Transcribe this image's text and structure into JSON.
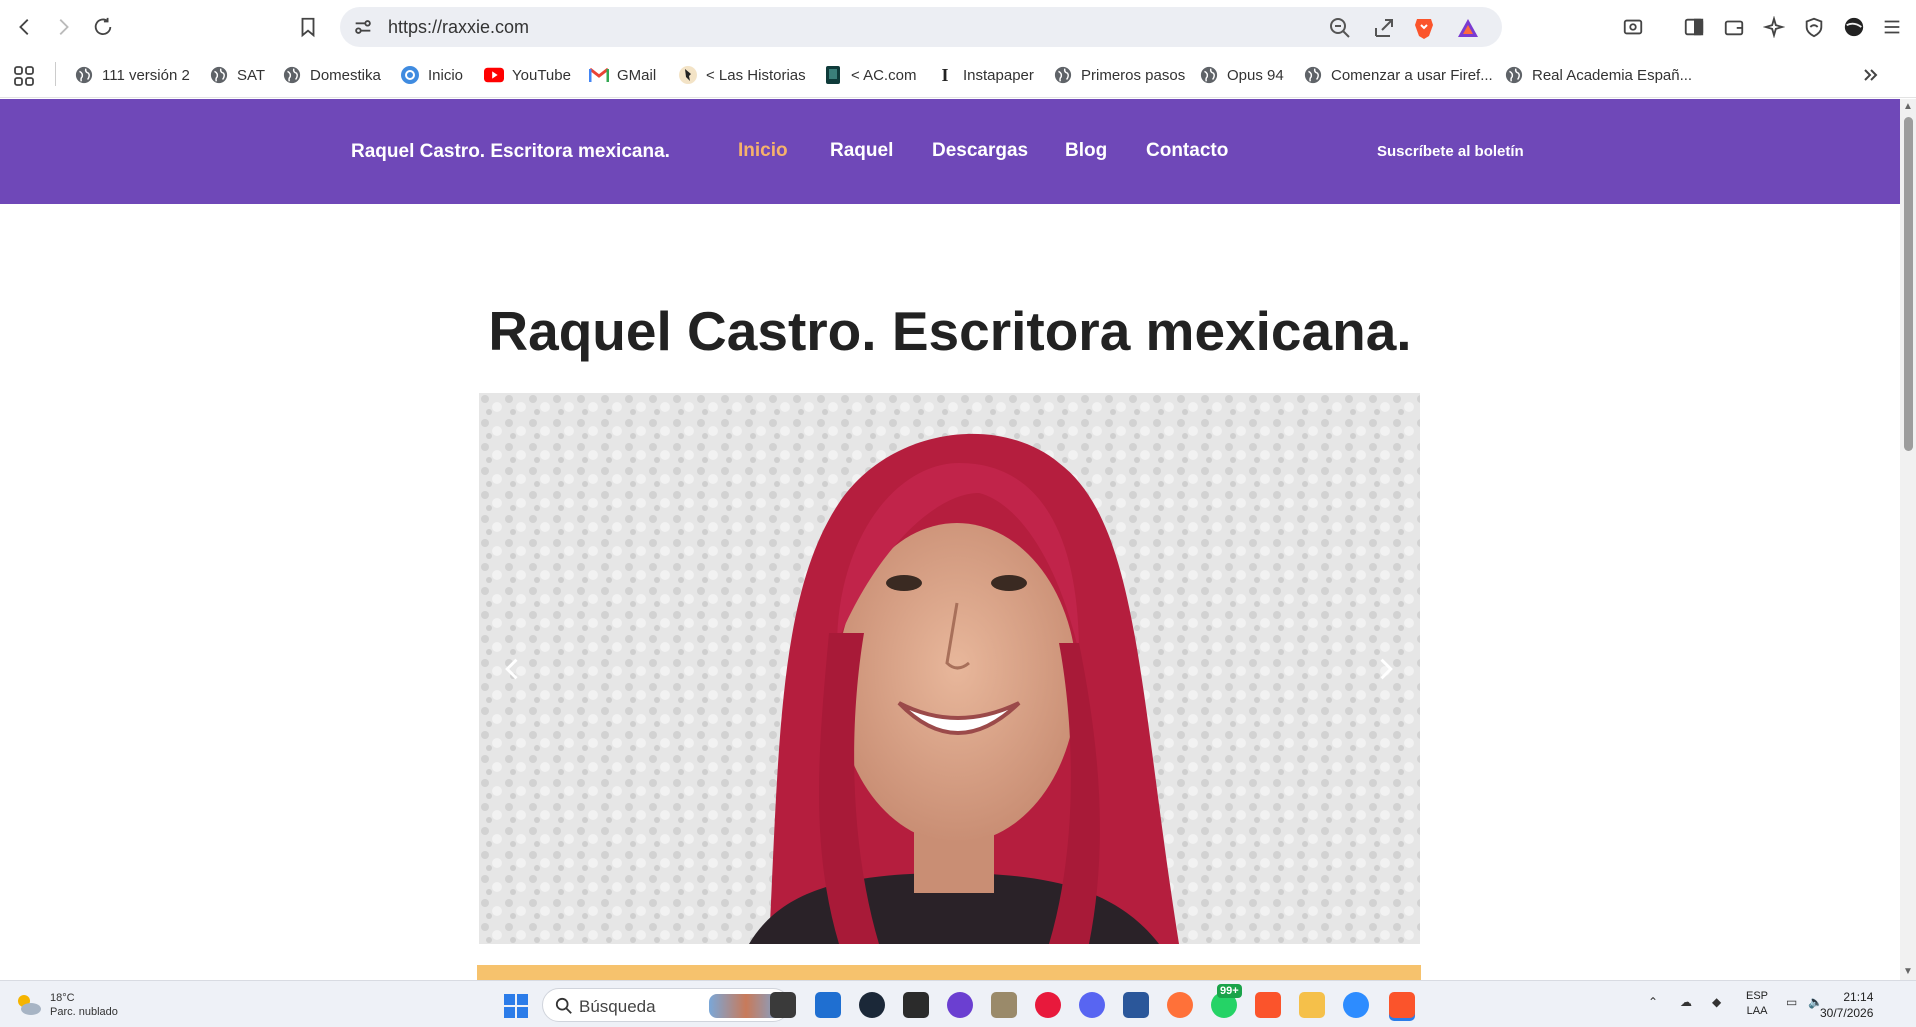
{
  "browser": {
    "url": "https://raxxie.com",
    "toolbar_icons": [
      "back-icon",
      "forward-icon",
      "reload-icon",
      "bookmark-icon",
      "site-info-icon",
      "zoom-icon",
      "share-icon",
      "brave-shield-icon",
      "brave-rewards-icon",
      "reader-mode-icon",
      "sidebar-icon",
      "wallet-icon",
      "leo-ai-icon",
      "vpn-icon",
      "profile-icon",
      "menu-icon"
    ]
  },
  "bookmarks": [
    {
      "label": "111 versión 2",
      "icon": "globe-icon"
    },
    {
      "label": "SAT",
      "icon": "globe-icon"
    },
    {
      "label": "Domestika",
      "icon": "globe-icon"
    },
    {
      "label": "Inicio",
      "icon": "canva-icon"
    },
    {
      "label": "YouTube",
      "icon": "youtube-icon"
    },
    {
      "label": "GMail",
      "icon": "gmail-icon"
    },
    {
      "label": "< Las Historias",
      "icon": "bird-icon"
    },
    {
      "label": "< AC.com",
      "icon": "book-icon"
    },
    {
      "label": "Instapaper",
      "icon": "instapaper-icon"
    },
    {
      "label": "Primeros pasos",
      "icon": "globe-icon"
    },
    {
      "label": "Opus 94",
      "icon": "globe-icon"
    },
    {
      "label": "Comenzar a usar Firef...",
      "icon": "globe-icon"
    },
    {
      "label": "Real Academia Españ...",
      "icon": "globe-icon"
    }
  ],
  "site": {
    "title": "Raquel Castro. Escritora mexicana.",
    "nav": [
      "Inicio",
      "Raquel",
      "Descargas",
      "Blog",
      "Contacto"
    ],
    "active_nav": "Inicio",
    "subscribe_label": "Suscríbete al boletín",
    "heading": "Raquel Castro. Escritora mexicana.",
    "colors": {
      "header": "#6f48b8",
      "active_nav": "#f6b26b",
      "accent_strip": "#f6c26d"
    }
  },
  "taskbar": {
    "weather_temp": "18°C",
    "weather_desc": "Parc. nublado",
    "search_placeholder": "Búsqueda",
    "whatsapp_badge": "99+",
    "lang_top": "ESP",
    "lang_bottom": "LAA",
    "time": "21:14",
    "date": "30/7/2026"
  }
}
